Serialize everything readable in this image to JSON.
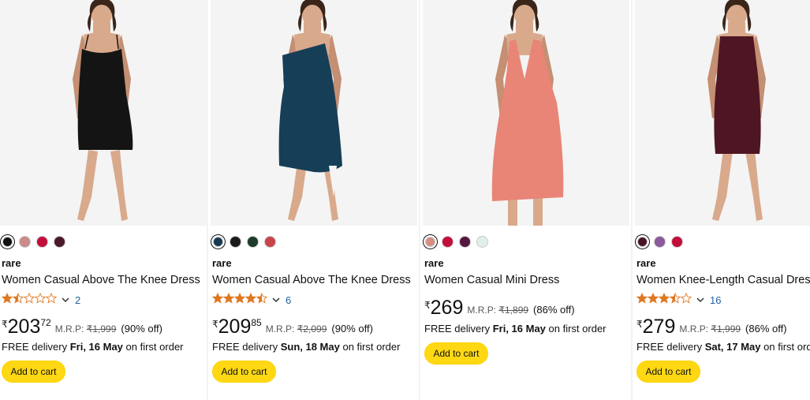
{
  "products": [
    {
      "brand": "rare",
      "title": "Women Casual Above The Knee Dress",
      "swatches": [
        "#111111",
        "#c98b88",
        "#c30d3a",
        "#4a1a2a"
      ],
      "selected_swatch": 0,
      "rating_stars": 1.5,
      "rating_count": "2",
      "price_symbol": "₹",
      "price_whole": "203",
      "price_fraction": "72",
      "mrp_label": "M.R.P:",
      "mrp_value": "₹1,999",
      "discount": "(90% off)",
      "delivery_prefix": "FREE delivery",
      "delivery_date": "Fri, 16 May",
      "delivery_suffix": "on first order",
      "add_to_cart": "Add to cart",
      "dress_color": "#141414",
      "dress_style": "slip"
    },
    {
      "brand": "rare",
      "title": "Women Casual Above The Knee Dress",
      "swatches": [
        "#163a52",
        "#1a1a1a",
        "#1f3b2a",
        "#c7444a"
      ],
      "selected_swatch": 0,
      "rating_stars": 4.5,
      "rating_count": "6",
      "price_symbol": "₹",
      "price_whole": "209",
      "price_fraction": "85",
      "mrp_label": "M.R.P:",
      "mrp_value": "₹2,099",
      "discount": "(90% off)",
      "delivery_prefix": "FREE delivery",
      "delivery_date": "Sun, 18 May",
      "delivery_suffix": "on first order",
      "add_to_cart": "Add to cart",
      "dress_color": "#173e57",
      "dress_style": "oneshoulder"
    },
    {
      "brand": "rare",
      "title": "Women Casual Mini Dress",
      "swatches": [
        "#d88c82",
        "#c30d3a",
        "#55173f",
        "#dff0e8"
      ],
      "selected_swatch": 0,
      "rating_stars": 0,
      "rating_count": "",
      "price_symbol": "₹",
      "price_whole": "269",
      "price_fraction": "",
      "mrp_label": "M.R.P:",
      "mrp_value": "₹1,899",
      "discount": "(86% off)",
      "delivery_prefix": "FREE delivery",
      "delivery_date": "Fri, 16 May",
      "delivery_suffix": "on first order",
      "add_to_cart": "Add to cart",
      "dress_color": "#e88577",
      "dress_style": "halter"
    },
    {
      "brand": "rare",
      "title": "Women Knee-Length Casual Dress",
      "swatches": [
        "#4a1426",
        "#8b5a9b",
        "#c30d3a"
      ],
      "selected_swatch": 0,
      "rating_stars": 3.5,
      "rating_count": "16",
      "price_symbol": "₹",
      "price_whole": "279",
      "price_fraction": "",
      "mrp_label": "M.R.P:",
      "mrp_value": "₹1,999",
      "discount": "(86% off)",
      "delivery_prefix": "FREE delivery",
      "delivery_date": "Sat, 17 May",
      "delivery_suffix": "on first order",
      "add_to_cart": "Add to cart",
      "dress_color": "#4e1622",
      "dress_style": "sheath"
    }
  ],
  "colors": {
    "star": "#de7921",
    "link": "#2162a1",
    "button": "#ffd814"
  }
}
